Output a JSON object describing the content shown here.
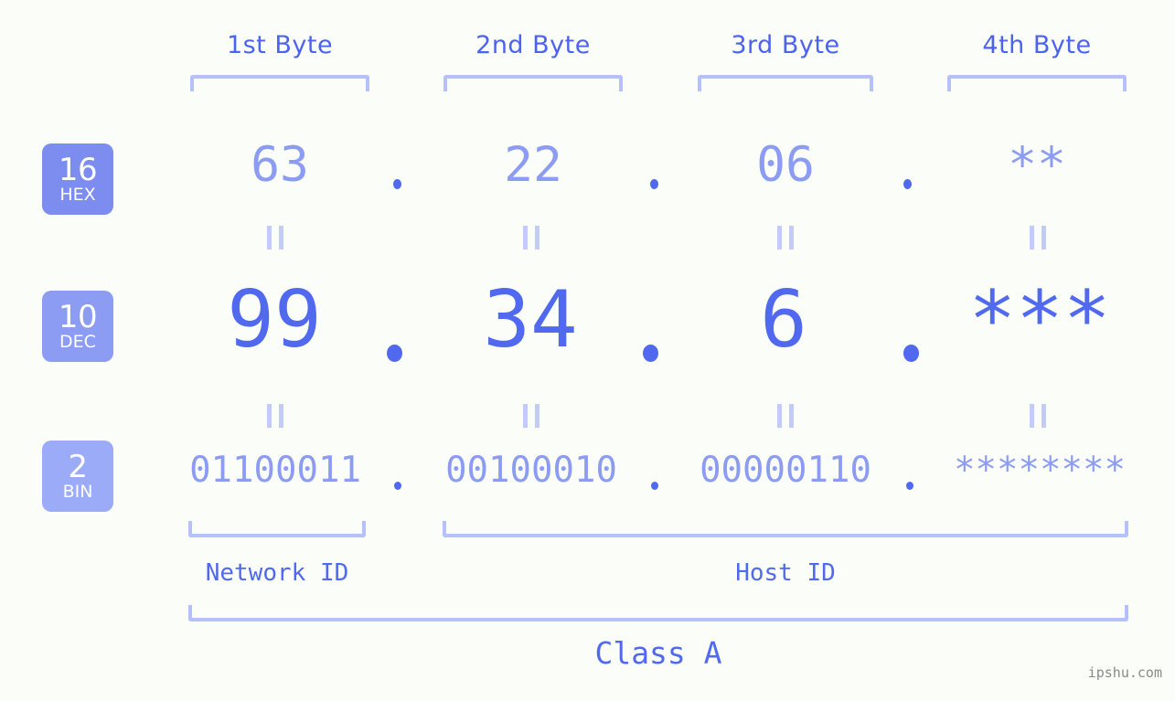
{
  "watermark": "ipshu.com",
  "byte_headers": [
    {
      "label": "1st Byte"
    },
    {
      "label": "2nd Byte"
    },
    {
      "label": "3rd Byte"
    },
    {
      "label": "4th Byte"
    }
  ],
  "bases": [
    {
      "number": "16",
      "name": "HEX",
      "color": "#7c8cef"
    },
    {
      "number": "10",
      "name": "DEC",
      "color": "#8c9cf2"
    },
    {
      "number": "2",
      "name": "BIN",
      "color": "#9cabf7"
    }
  ],
  "rows": {
    "hex": {
      "base_number": "16",
      "base_name": "HEX",
      "values": [
        "63",
        "22",
        "06",
        "**"
      ]
    },
    "dec": {
      "base_number": "10",
      "base_name": "DEC",
      "values": [
        "99",
        "34",
        "6",
        "***"
      ]
    },
    "bin": {
      "base_number": "2",
      "base_name": "BIN",
      "values": [
        "01100011",
        "00100010",
        "00000110",
        "********"
      ]
    }
  },
  "separator": ".",
  "equals": "=",
  "segments": {
    "network_id": "Network ID",
    "host_id": "Host ID",
    "class": "Class A"
  },
  "colors": {
    "background": "#fbfdf8",
    "accent_strong": "#5069ef",
    "accent_light": "#8c9cf2",
    "bracket": "#b6c0fb",
    "equals": "#c3cbfb",
    "watermark": "#8a8a8a"
  }
}
